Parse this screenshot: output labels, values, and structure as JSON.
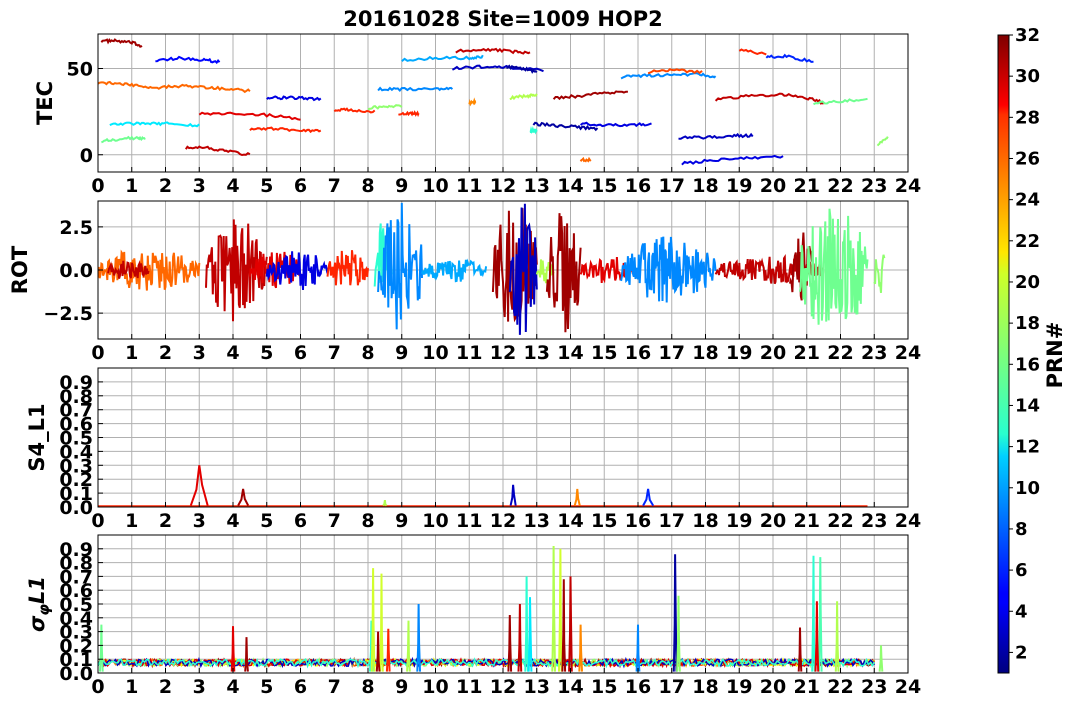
{
  "chart_data": {
    "type": "line",
    "title": "20161028 Site=1009 HOP2",
    "xlabel": "",
    "x_ticks": [
      "0",
      "1",
      "2",
      "3",
      "4",
      "5",
      "6",
      "7",
      "8",
      "9",
      "10",
      "11",
      "12",
      "13",
      "14",
      "15",
      "16",
      "17",
      "18",
      "19",
      "20",
      "21",
      "22",
      "23",
      "24"
    ],
    "xlim": [
      0,
      24
    ],
    "grid": true,
    "colorbar": {
      "label": "PRN#",
      "range": [
        1,
        32
      ],
      "ticks": [
        "2",
        "4",
        "6",
        "8",
        "10",
        "12",
        "14",
        "16",
        "18",
        "20",
        "22",
        "24",
        "26",
        "28",
        "30",
        "32"
      ],
      "colormap": "jet"
    },
    "panels": [
      {
        "ylabel": "TEC",
        "ylim": [
          -10,
          70
        ],
        "yticks": [
          "0",
          "50"
        ],
        "series": [
          {
            "prn": 31,
            "x": [
              0.1,
              0.5,
              1.0,
              1.3
            ],
            "y": [
              66,
              66,
              65,
              63
            ]
          },
          {
            "prn": 25,
            "x": [
              0.0,
              0.6,
              1.2,
              1.8,
              2.5,
              3.2,
              3.9,
              4.5
            ],
            "y": [
              42,
              41,
              40,
              39,
              40,
              39,
              38,
              37
            ]
          },
          {
            "prn": 12,
            "x": [
              0.35,
              1.0,
              1.6,
              2.2,
              3.0
            ],
            "y": [
              18,
              18,
              18,
              18,
              17
            ]
          },
          {
            "prn": 16,
            "x": [
              0.1,
              0.6,
              1.2,
              1.4
            ],
            "y": [
              8,
              9,
              10,
              9
            ]
          },
          {
            "prn": 5,
            "x": [
              1.7,
              2.4,
              3.1,
              3.6
            ],
            "y": [
              55,
              56,
              55,
              54
            ]
          },
          {
            "prn": 30,
            "x": [
              2.6,
              3.2,
              3.8,
              4.5
            ],
            "y": [
              4,
              4,
              2,
              0
            ]
          },
          {
            "prn": 29,
            "x": [
              3.0,
              4.0,
              5.0,
              6.0
            ],
            "y": [
              24,
              24,
              23,
              21
            ]
          },
          {
            "prn": 27,
            "x": [
              4.5,
              5.2,
              6.0,
              6.6
            ],
            "y": [
              15,
              15,
              14,
              14
            ]
          },
          {
            "prn": 4,
            "x": [
              5.0,
              5.5,
              6.0,
              6.6
            ],
            "y": [
              33,
              33,
              33,
              32
            ]
          },
          {
            "prn": 27,
            "x": [
              7.0,
              7.5,
              8.2
            ],
            "y": [
              26,
              26,
              25
            ]
          },
          {
            "prn": 17,
            "x": [
              8.0,
              8.5,
              9.0
            ],
            "y": [
              27,
              28,
              28
            ]
          },
          {
            "prn": 27,
            "x": [
              8.9,
              9.3,
              9.5
            ],
            "y": [
              24,
              24,
              24
            ]
          },
          {
            "prn": 9,
            "x": [
              8.3,
              9.0,
              10.0,
              10.5
            ],
            "y": [
              38,
              38,
              38,
              38
            ]
          },
          {
            "prn": 10,
            "x": [
              9.0,
              10.0,
              11.0,
              11.4
            ],
            "y": [
              55,
              56,
              56,
              57
            ]
          },
          {
            "prn": 24,
            "x": [
              11.0,
              11.2
            ],
            "y": [
              30,
              31
            ]
          },
          {
            "prn": 30,
            "x": [
              10.6,
              11.5,
              12.2,
              12.8
            ],
            "y": [
              60,
              61,
              60,
              59
            ]
          },
          {
            "prn": 3,
            "x": [
              10.5,
              11.3,
              12.0,
              13.2
            ],
            "y": [
              50,
              51,
              51,
              49
            ]
          },
          {
            "prn": 2,
            "x": [
              12.1,
              12.6,
              13.0
            ],
            "y": [
              51,
              50,
              48
            ]
          },
          {
            "prn": 18,
            "x": [
              12.2,
              12.7,
              13.0
            ],
            "y": [
              33,
              34,
              35
            ]
          },
          {
            "prn": 14,
            "x": [
              12.8,
              13.0
            ],
            "y": [
              14,
              14
            ]
          },
          {
            "prn": 2,
            "x": [
              12.9,
              13.5,
              14.2,
              14.8
            ],
            "y": [
              18,
              17,
              16,
              15
            ]
          },
          {
            "prn": 31,
            "x": [
              13.5,
              14.2,
              15.0,
              15.7
            ],
            "y": [
              33,
              34,
              36,
              37
            ]
          },
          {
            "prn": 4,
            "x": [
              14.3,
              15.0,
              15.8,
              16.4
            ],
            "y": [
              18,
              17,
              17,
              18
            ]
          },
          {
            "prn": 25,
            "x": [
              14.3,
              14.6
            ],
            "y": [
              -3,
              -3
            ]
          },
          {
            "prn": 9,
            "x": [
              15.5,
              16.2,
              17.0,
              17.8,
              18.3
            ],
            "y": [
              45,
              46,
              46,
              47,
              45
            ]
          },
          {
            "prn": 26,
            "x": [
              16.3,
              17.0,
              17.9
            ],
            "y": [
              48,
              49,
              48
            ]
          },
          {
            "prn": 3,
            "x": [
              17.2,
              18.0,
              18.8,
              19.4
            ],
            "y": [
              10,
              10,
              11,
              11
            ]
          },
          {
            "prn": 4,
            "x": [
              17.3,
              18.3,
              19.3,
              20.3
            ],
            "y": [
              -5,
              -3,
              -2,
              -1
            ]
          },
          {
            "prn": 30,
            "x": [
              18.3,
              19.2,
              20.2,
              21.0,
              21.5
            ],
            "y": [
              32,
              34,
              35,
              33,
              30
            ]
          },
          {
            "prn": 27,
            "x": [
              19.0,
              19.8
            ],
            "y": [
              61,
              58
            ]
          },
          {
            "prn": 6,
            "x": [
              19.8,
              20.4,
              21.2
            ],
            "y": [
              57,
              57,
              54
            ]
          },
          {
            "prn": 16,
            "x": [
              21.2,
              22.0,
              22.8
            ],
            "y": [
              30,
              31,
              32
            ]
          },
          {
            "prn": 17,
            "x": [
              23.1,
              23.4
            ],
            "y": [
              6,
              10
            ]
          }
        ]
      },
      {
        "ylabel": "ROT",
        "ylim": [
          -4,
          4
        ],
        "yticks": [
          "−2.5",
          "0.0",
          "2.5"
        ],
        "bursts": [
          {
            "prn": 25,
            "t0": 0.0,
            "t1": 3.0,
            "amp": 1.3
          },
          {
            "prn": 30,
            "t0": 0.3,
            "t1": 1.5,
            "amp": 0.6
          },
          {
            "prn": 30,
            "t0": 3.2,
            "t1": 5.0,
            "amp": 3.2
          },
          {
            "prn": 29,
            "t0": 4.5,
            "t1": 6.0,
            "amp": 1.2
          },
          {
            "prn": 4,
            "t0": 5.0,
            "t1": 6.8,
            "amp": 1.2
          },
          {
            "prn": 27,
            "t0": 6.8,
            "t1": 8.0,
            "amp": 1.2
          },
          {
            "prn": 14,
            "t0": 8.2,
            "t1": 8.7,
            "amp": 3.0
          },
          {
            "prn": 9,
            "t0": 8.3,
            "t1": 9.6,
            "amp": 4.0
          },
          {
            "prn": 10,
            "t0": 9.6,
            "t1": 11.5,
            "amp": 0.7
          },
          {
            "prn": 31,
            "t0": 11.7,
            "t1": 13.0,
            "amp": 4.0
          },
          {
            "prn": 3,
            "t0": 12.2,
            "t1": 13.0,
            "amp": 4.0
          },
          {
            "prn": 18,
            "t0": 13.0,
            "t1": 13.5,
            "amp": 0.8
          },
          {
            "prn": 31,
            "t0": 13.3,
            "t1": 14.3,
            "amp": 4.0
          },
          {
            "prn": 29,
            "t0": 14.3,
            "t1": 16.0,
            "amp": 0.8
          },
          {
            "prn": 9,
            "t0": 15.5,
            "t1": 18.3,
            "amp": 2.0
          },
          {
            "prn": 30,
            "t0": 18.3,
            "t1": 21.5,
            "amp": 0.8
          },
          {
            "prn": 31,
            "t0": 20.5,
            "t1": 21.2,
            "amp": 2.5
          },
          {
            "prn": 16,
            "t0": 20.8,
            "t1": 22.8,
            "amp": 4.0
          },
          {
            "prn": 17,
            "t0": 23.0,
            "t1": 23.3,
            "amp": 2.2
          }
        ]
      },
      {
        "ylabel": "S4_L1",
        "ylim": [
          0,
          1.0
        ],
        "yticks": [
          "0.0",
          "0.1",
          "0.2",
          "0.3",
          "0.4",
          "0.5",
          "0.6",
          "0.7",
          "0.8",
          "0.9"
        ],
        "spikes": [
          {
            "prn": 29,
            "t": 3.0,
            "peak": 0.3,
            "width": 0.5
          },
          {
            "prn": 31,
            "t": 4.3,
            "peak": 0.13,
            "width": 0.3
          },
          {
            "prn": 18,
            "t": 8.5,
            "peak": 0.05,
            "width": 0.1
          },
          {
            "prn": 3,
            "t": 12.3,
            "peak": 0.16,
            "width": 0.15
          },
          {
            "prn": 24,
            "t": 14.2,
            "peak": 0.13,
            "width": 0.15
          },
          {
            "prn": 6,
            "t": 16.3,
            "peak": 0.13,
            "width": 0.3
          }
        ]
      },
      {
        "ylabel": "σ_φL1",
        "ylim": [
          0,
          1.0
        ],
        "yticks": [
          "0.0",
          "0.1",
          "0.2",
          "0.3",
          "0.4",
          "0.5",
          "0.6",
          "0.7",
          "0.8",
          "0.9"
        ],
        "spikes": [
          {
            "prn": 16,
            "t": 0.1,
            "peak": 0.35
          },
          {
            "prn": 29,
            "t": 4.0,
            "peak": 0.34
          },
          {
            "prn": 31,
            "t": 4.4,
            "peak": 0.26
          },
          {
            "prn": 14,
            "t": 8.1,
            "peak": 0.38
          },
          {
            "prn": 19,
            "t": 8.15,
            "peak": 0.76
          },
          {
            "prn": 19,
            "t": 8.4,
            "peak": 0.72
          },
          {
            "prn": 31,
            "t": 8.3,
            "peak": 0.3
          },
          {
            "prn": 27,
            "t": 8.6,
            "peak": 0.32
          },
          {
            "prn": 9,
            "t": 9.5,
            "peak": 0.5
          },
          {
            "prn": 18,
            "t": 9.2,
            "peak": 0.38
          },
          {
            "prn": 31,
            "t": 12.2,
            "peak": 0.42
          },
          {
            "prn": 30,
            "t": 12.5,
            "peak": 0.5
          },
          {
            "prn": 14,
            "t": 12.7,
            "peak": 0.7
          },
          {
            "prn": 12,
            "t": 12.8,
            "peak": 0.55
          },
          {
            "prn": 18,
            "t": 13.5,
            "peak": 0.92
          },
          {
            "prn": 19,
            "t": 13.7,
            "peak": 0.9
          },
          {
            "prn": 31,
            "t": 13.8,
            "peak": 0.68
          },
          {
            "prn": 30,
            "t": 14.0,
            "peak": 0.7
          },
          {
            "prn": 24,
            "t": 14.3,
            "peak": 0.35
          },
          {
            "prn": 9,
            "t": 16.0,
            "peak": 0.35
          },
          {
            "prn": 2,
            "t": 17.1,
            "peak": 0.86
          },
          {
            "prn": 17,
            "t": 17.2,
            "peak": 0.56
          },
          {
            "prn": 31,
            "t": 20.8,
            "peak": 0.33
          },
          {
            "prn": 14,
            "t": 21.2,
            "peak": 0.85
          },
          {
            "prn": 15,
            "t": 21.4,
            "peak": 0.84
          },
          {
            "prn": 29,
            "t": 21.3,
            "peak": 0.52
          },
          {
            "prn": 18,
            "t": 21.9,
            "peak": 0.52
          },
          {
            "prn": 17,
            "t": 23.2,
            "peak": 0.2
          }
        ]
      }
    ]
  }
}
